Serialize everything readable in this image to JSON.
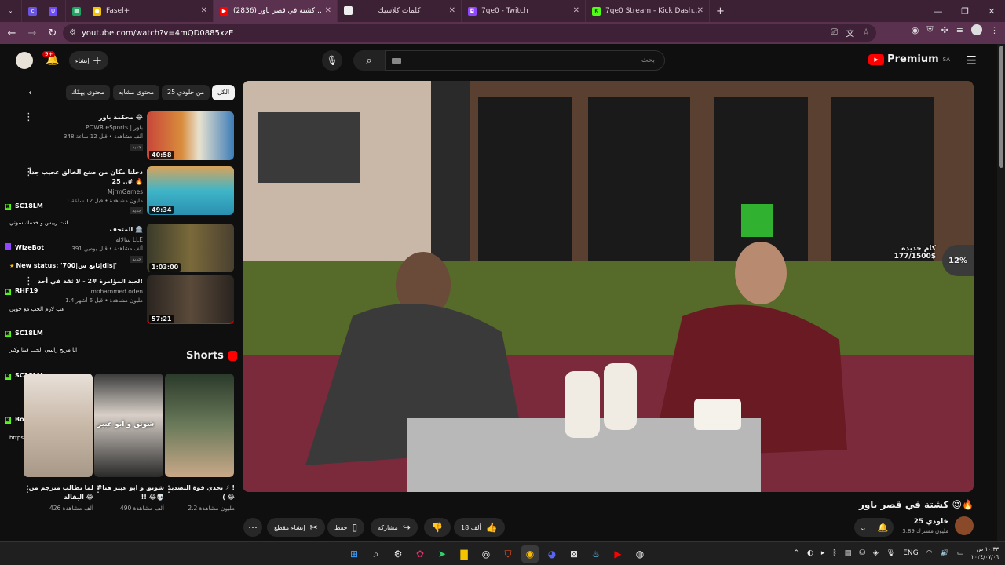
{
  "browser": {
    "tabs": [
      {
        "label": "",
        "icon": "dropdown-icon",
        "color": "#3c2033"
      },
      {
        "label": "",
        "icon": "c-icon",
        "color": "#6a55e0"
      },
      {
        "label": "",
        "icon": "proton-icon",
        "color": "#6d4aff"
      },
      {
        "label": "",
        "icon": "sheets-icon",
        "color": "#1fa463"
      },
      {
        "label": "Fasel+",
        "icon": "bulb-icon",
        "color": "#f5c400"
      },
      {
        "label": "(2836) كشتة في قصر باور 🔥😍",
        "icon": "youtube-icon",
        "color": "#ff0000",
        "active": true
      },
      {
        "label": "كلمات كلاسيك",
        "icon": "doc-icon",
        "color": "#eeeeee"
      },
      {
        "label": "7qe0 - Twitch",
        "icon": "twitch-icon",
        "color": "#9146ff"
      },
      {
        "label": "7qe0 Stream - Kick Dashboard",
        "icon": "kick-icon",
        "color": "#53fc18"
      }
    ],
    "new_tab": "+",
    "url": "youtube.com/watch?v=4mQD0885xzE"
  },
  "youtube": {
    "brand": "Premium",
    "region": "SA",
    "search_placeholder": "بحث",
    "create_label": "إنشاء",
    "notif_count": "9+",
    "chips": [
      "الكل",
      "من خلودي 25",
      "محتوى مشابه",
      "محتوى يهمّك"
    ],
    "recommendations": [
      {
        "title": "محكمة باور 😂",
        "channel": "POWR eSports | باور",
        "meta": "348 ألف مشاهدة • قبل 12 ساعة",
        "new": "جديد",
        "duration": "40:58"
      },
      {
        "title": "دخلنا مكان من صنع الخالق عجيب جداً .. 25# 🔥",
        "channel": "MjrmGames",
        "meta": "1 مليون مشاهدة • قبل 12 ساعة",
        "new": "جديد",
        "duration": "49:34"
      },
      {
        "title": "المتحف 🏛️",
        "channel": "سالالة LLE",
        "meta": "391 ألف مشاهدة • قبل يومين",
        "new": "جديد",
        "duration": "1:03:00"
      },
      {
        "title": "لعبة المؤامرة #2 - لا ثقة في أحد!",
        "channel": "mohammed oden",
        "meta": "1.4 مليون مشاهدة • قبل 6 أشهر",
        "new": "",
        "duration": "57:21"
      }
    ],
    "shorts_heading": "Shorts",
    "shorts": [
      {
        "title": "تحدي قوة التصديد ⚡ ! ( 😂",
        "views": "2.2 مليون مشاهدة"
      },
      {
        "title": "#شوتق و ابو عبير هنا !! 😂💀",
        "views": "490 ألف مشاهدة"
      },
      {
        "title": "لما تطالب مترجم من البقالة 😂",
        "views": "426 ألف مشاهدة"
      }
    ],
    "short_overlay_text": "شوتق و ابو عبير",
    "video": {
      "title": "كشتة في قصر باور 😍🔥",
      "channel": "خلودي 25",
      "subscribers": "3.89 مليون مشترك",
      "likes": "18 ألف",
      "actions": [
        "مشاركة",
        "حفظ",
        "إنشاء مقطع"
      ]
    },
    "goal_overlay": {
      "label": "كام جديده",
      "amount": "177/1500$",
      "percent": "12%",
      "progress": 0.12
    }
  },
  "chat_overlay": [
    {
      "user": "SC18LM",
      "platform": "kick",
      "msg": "انت رييس و خدمك سوني"
    },
    {
      "user": "WizeBot",
      "platform": "twitch",
      "msg": ""
    },
    {
      "user": "",
      "platform": "",
      "msg": "New status: '700|تابع س|dis|'"
    },
    {
      "user": "RHF19",
      "platform": "kick",
      "msg": "عب لازم الحب مع خويي"
    },
    {
      "user": "SC18LM",
      "platform": "kick",
      "msg": "انا مريح راسي الحب فينا وكبر"
    },
    {
      "user": "SC18LM",
      "platform": "kick",
      "msg": ""
    },
    {
      "user": "BotRix",
      "platform": "kick",
      "msg": "https://discord.gg/7q..."
    }
  ],
  "taskbar": {
    "lang": "ENG",
    "time": "١٠:٣٣ ص",
    "date": "٢٠٢٤/٠٧/٠٦"
  }
}
